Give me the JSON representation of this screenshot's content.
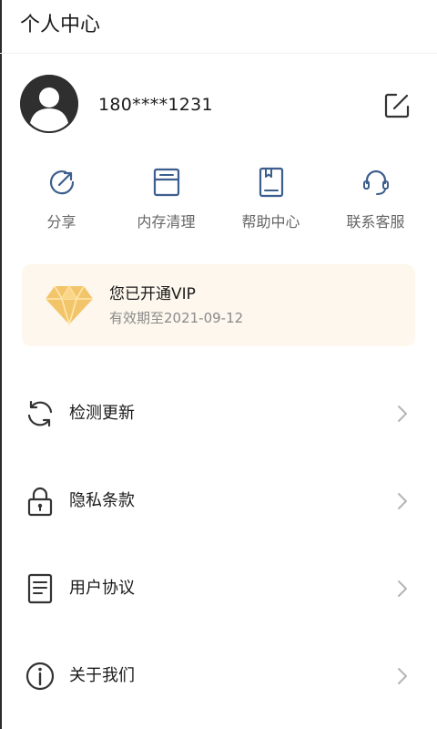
{
  "header": {
    "title": "个人中心"
  },
  "profile": {
    "avatar_icon": "user-avatar-icon",
    "phone": "180****1231",
    "edit_icon": "edit-icon"
  },
  "shortcuts": [
    {
      "label": "分享",
      "icon": "share-icon"
    },
    {
      "label": "内存清理",
      "icon": "storage-clean-icon"
    },
    {
      "label": "帮助中心",
      "icon": "help-book-icon"
    },
    {
      "label": "联系客服",
      "icon": "headset-icon"
    }
  ],
  "vip": {
    "icon": "diamond-icon",
    "title": "您已开通VIP",
    "expiry": "有效期至2021-09-12"
  },
  "menu": [
    {
      "label": "检测更新",
      "icon": "refresh-icon"
    },
    {
      "label": "隐私条款",
      "icon": "lock-icon"
    },
    {
      "label": "用户协议",
      "icon": "document-icon"
    },
    {
      "label": "关于我们",
      "icon": "info-icon"
    }
  ],
  "colors": {
    "icon_accent": "#3c5e8e",
    "vip_background": "#fdf7ed",
    "diamond_gold": "#f3c56a",
    "text_primary": "#1a1a1a",
    "text_secondary": "#666666"
  }
}
